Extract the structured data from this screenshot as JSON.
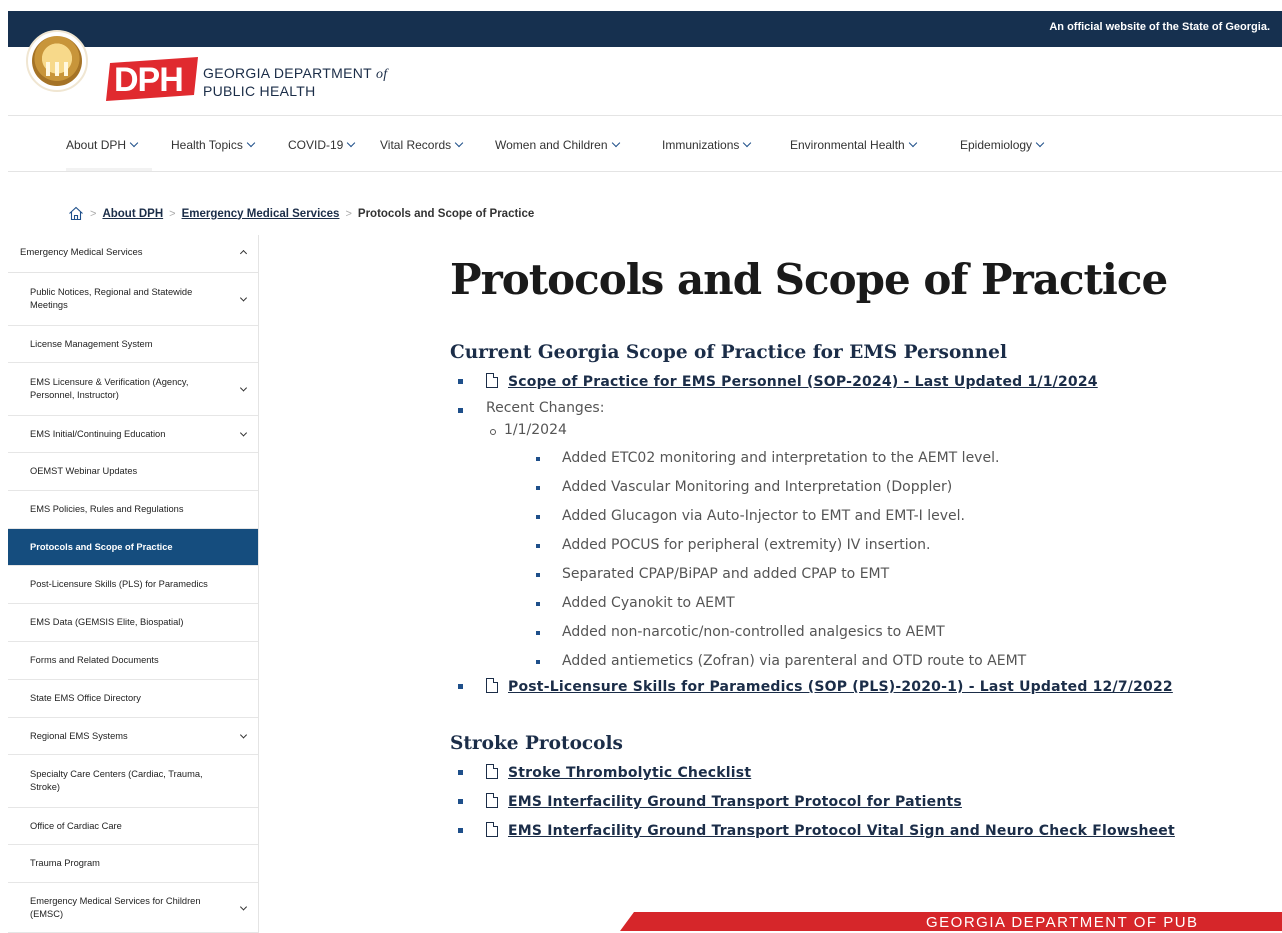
{
  "banner": {
    "text": "An official website of the State of Georgia."
  },
  "header": {
    "org_line1": "GEORGIA DEPARTMENT",
    "org_of": "of",
    "org_line2": "PUBLIC HEALTH",
    "logo_text": "DPH"
  },
  "nav": {
    "items": [
      "About DPH",
      "Health Topics",
      "COVID-19",
      "Vital Records",
      "Women and Children",
      "Immunizations",
      "Environmental Health",
      "Epidemiology"
    ]
  },
  "breadcrumb": {
    "home_icon": "home-icon",
    "items": [
      "About DPH",
      "Emergency Medical Services"
    ],
    "current": "Protocols and Scope of Practice"
  },
  "sidebar": {
    "heading": "Emergency Medical Services",
    "items": [
      {
        "label": "Public Notices, Regional and Statewide Meetings",
        "chevron": true
      },
      {
        "label": "License Management System",
        "chevron": false
      },
      {
        "label": "EMS Licensure & Verification (Agency, Personnel, Instructor)",
        "chevron": true
      },
      {
        "label": "EMS Initial/Continuing Education",
        "chevron": true
      },
      {
        "label": "OEMST Webinar Updates",
        "chevron": false
      },
      {
        "label": "EMS Policies, Rules and Regulations",
        "chevron": false
      },
      {
        "label": "Protocols and Scope of Practice",
        "chevron": false,
        "active": true
      },
      {
        "label": "Post-Licensure Skills (PLS) for Paramedics",
        "chevron": false
      },
      {
        "label": "EMS Data (GEMSIS Elite, Biospatial)",
        "chevron": false
      },
      {
        "label": "Forms and Related Documents",
        "chevron": false
      },
      {
        "label": "State EMS Office Directory",
        "chevron": false
      },
      {
        "label": "Regional EMS Systems",
        "chevron": true
      },
      {
        "label": "Specialty Care Centers (Cardiac, Trauma, Stroke)",
        "chevron": false
      },
      {
        "label": "Office of Cardiac Care",
        "chevron": false
      },
      {
        "label": "Trauma Program",
        "chevron": false
      },
      {
        "label": "Emergency Medical Services for Children (EMSC)",
        "chevron": true
      }
    ]
  },
  "main": {
    "title": "Protocols and Scope of Practice",
    "section1": {
      "heading": "Current Georgia Scope of Practice for EMS Personnel",
      "link1": "Scope of Practice for EMS Personnel (SOP-2024) - Last Updated 1/1/2024",
      "recent_label": "Recent Changes:",
      "date": "1/1/2024",
      "changes": [
        "Added ETC02 monitoring and interpretation to the AEMT level.",
        "Added Vascular Monitoring and Interpretation (Doppler)",
        "Added Glucagon via Auto-Injector to EMT and EMT-I level.",
        "Added POCUS for peripheral (extremity) IV insertion.",
        "Separated CPAP/BiPAP and added CPAP to EMT",
        "Added Cyanokit to AEMT",
        "Added non-narcotic/non-controlled analgesics to AEMT",
        "Added antiemetics (Zofran) via parenteral and OTD route to AEMT"
      ],
      "link2": "Post-Licensure Skills for Paramedics (SOP (PLS)-2020-1) - Last Updated 12/7/2022"
    },
    "section2": {
      "heading": "Stroke Protocols",
      "links": [
        "Stroke Thrombolytic Checklist",
        "EMS Interfacility Ground Transport Protocol for Patients",
        "EMS Interfacility Ground Transport Protocol Vital Sign and Neuro Check Flowsheet"
      ]
    }
  },
  "footer": {
    "band_text": "GEORGIA DEPARTMENT OF PUB"
  },
  "colors": {
    "navy": "#16304f",
    "link": "#1b2d48",
    "accent_blue": "#154d7e",
    "red": "#d6262a"
  }
}
